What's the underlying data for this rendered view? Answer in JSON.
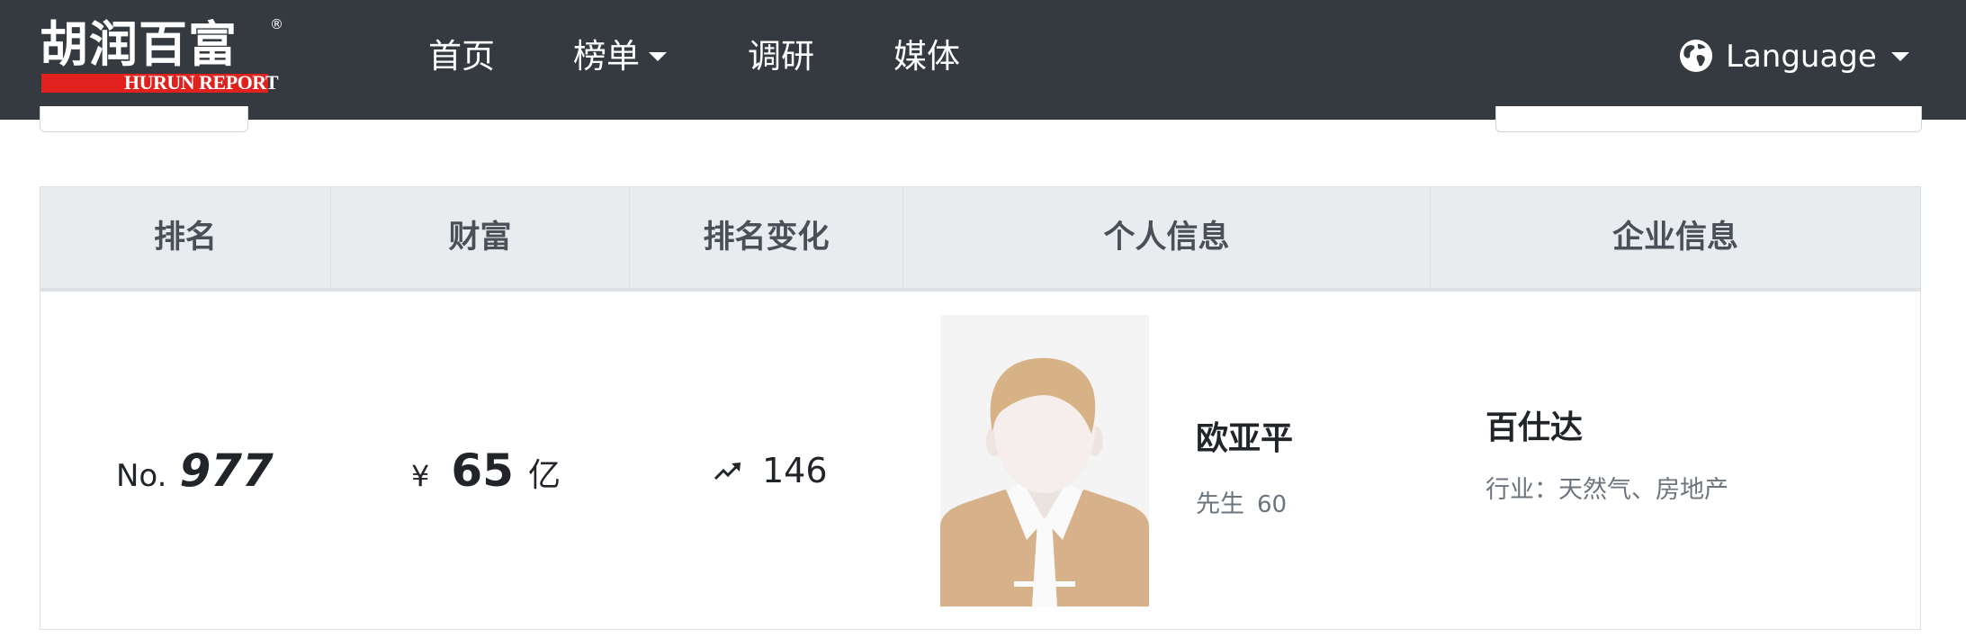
{
  "brand": {
    "logo_cn": "胡润百富",
    "logo_en": "HURUN REPORT",
    "registered_mark": "®"
  },
  "nav": {
    "items": [
      {
        "label": "首页",
        "has_dropdown": false
      },
      {
        "label": "榜单",
        "has_dropdown": true
      },
      {
        "label": "调研",
        "has_dropdown": false
      },
      {
        "label": "媒体",
        "has_dropdown": false
      }
    ],
    "language_label": "Language",
    "language_icon": "globe-icon"
  },
  "table": {
    "headers": [
      "排名",
      "财富",
      "排名变化",
      "个人信息",
      "企业信息"
    ],
    "rows": [
      {
        "rank_prefix": "No.",
        "rank": "977",
        "currency": "¥",
        "wealth": "65",
        "wealth_unit": "亿",
        "rank_change_icon": "trending-up-icon",
        "rank_change": "146",
        "person_name": "欧亚平",
        "person_title": "先生",
        "person_age": "60",
        "company": "百仕达",
        "industry": "行业：天然气、房地产"
      }
    ]
  },
  "colors": {
    "navbar_bg": "#343a40",
    "header_bg": "#e9ecef",
    "brand_red": "#e1211e",
    "avatar_hair": "#d8b287",
    "avatar_suit": "#d7b18a"
  }
}
